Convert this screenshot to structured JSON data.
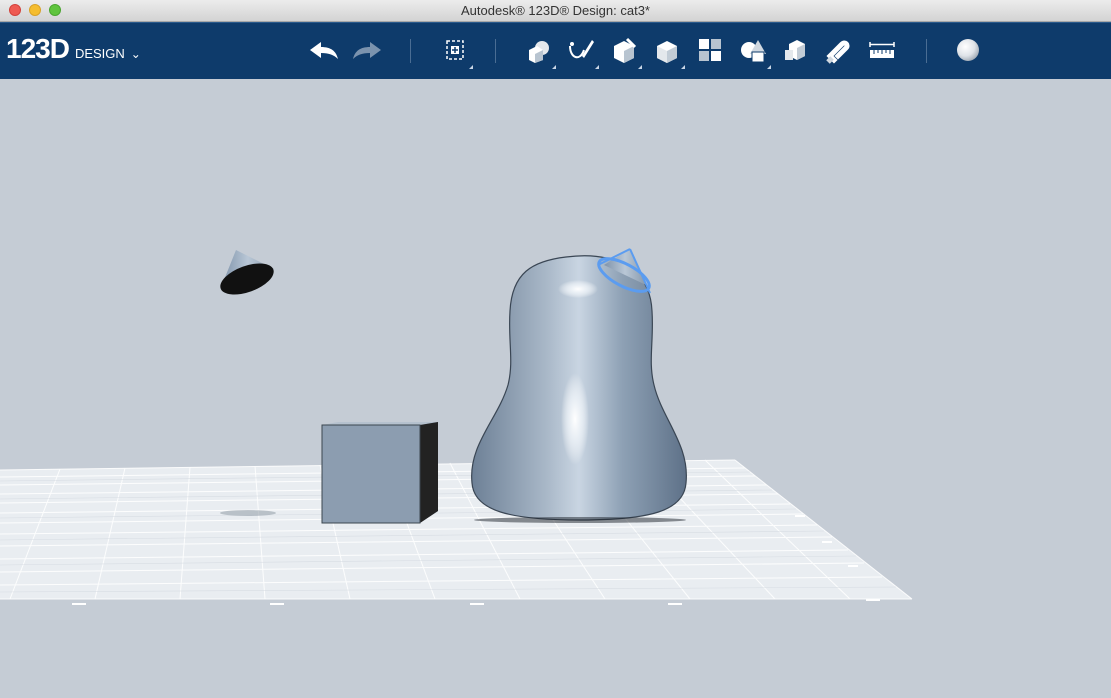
{
  "window": {
    "title": "Autodesk® 123D® Design: cat3*"
  },
  "app": {
    "logo_main": "123D",
    "logo_sub": "DESIGN"
  },
  "toolbar": {
    "history": [
      "undo",
      "redo"
    ],
    "tools": [
      "transform",
      "primitives",
      "sketch",
      "construct",
      "modify",
      "pattern",
      "grouping",
      "combine",
      "snap",
      "measure",
      "material"
    ]
  },
  "icons": {
    "undo": "undo-arrow-icon",
    "redo": "redo-arrow-icon",
    "transform": "transform-icon",
    "primitives": "primitives-icon",
    "sketch": "sketch-icon",
    "construct": "construct-icon",
    "modify": "modify-icon",
    "pattern": "pattern-icon",
    "grouping": "grouping-icon",
    "combine": "combine-icon",
    "snap": "snap-magnet-icon",
    "measure": "ruler-icon",
    "material": "material-sphere-icon"
  },
  "colors": {
    "toolbar_bg": "#0e3b6b",
    "viewport_bg": "#c5ccd5",
    "selection": "#5b9cf0",
    "object": "#8fa3b8"
  }
}
